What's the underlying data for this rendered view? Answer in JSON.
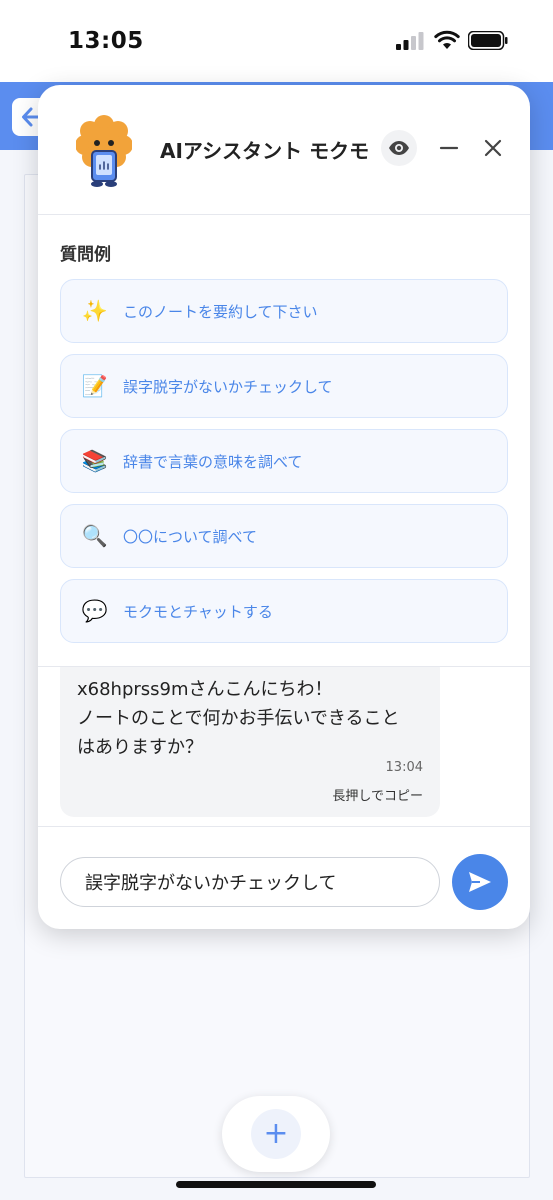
{
  "status_bar": {
    "time": "13:05",
    "icons": [
      "signal-icon",
      "wifi-icon",
      "battery-icon"
    ]
  },
  "background_app": {
    "header_color": "#5b8def",
    "back_icon": "arrow-left-icon",
    "fab_icon": "plus-icon",
    "fab_label": "+"
  },
  "assistant": {
    "title": "AIアシスタント モクモ",
    "header_icons": [
      "mascot-icon",
      "eye-icon",
      "minimize-icon",
      "close-icon"
    ],
    "examples_heading": "質問例",
    "examples": [
      {
        "emoji": "✨",
        "label": "このノートを要約して下さい"
      },
      {
        "emoji": "📝",
        "label": "誤字脱字がないかチェックして"
      },
      {
        "emoji": "📚",
        "label": "辞書で言葉の意味を調べて"
      },
      {
        "emoji": "🔍",
        "label": "〇〇について調べて"
      },
      {
        "emoji": "💬",
        "label": "モクモとチャットする"
      }
    ],
    "message": {
      "lines": [
        "x68hprss9mさんこんにちわ！",
        "ノートのことで何かお手伝いできること",
        "はありますか？"
      ],
      "time": "13:04",
      "copy_hint": "長押しでコピー"
    },
    "input": {
      "value": "誤字脱字がないかチェックして",
      "placeholder": ""
    },
    "send_icon": "send-icon",
    "accent_color": "#4a86e8"
  }
}
